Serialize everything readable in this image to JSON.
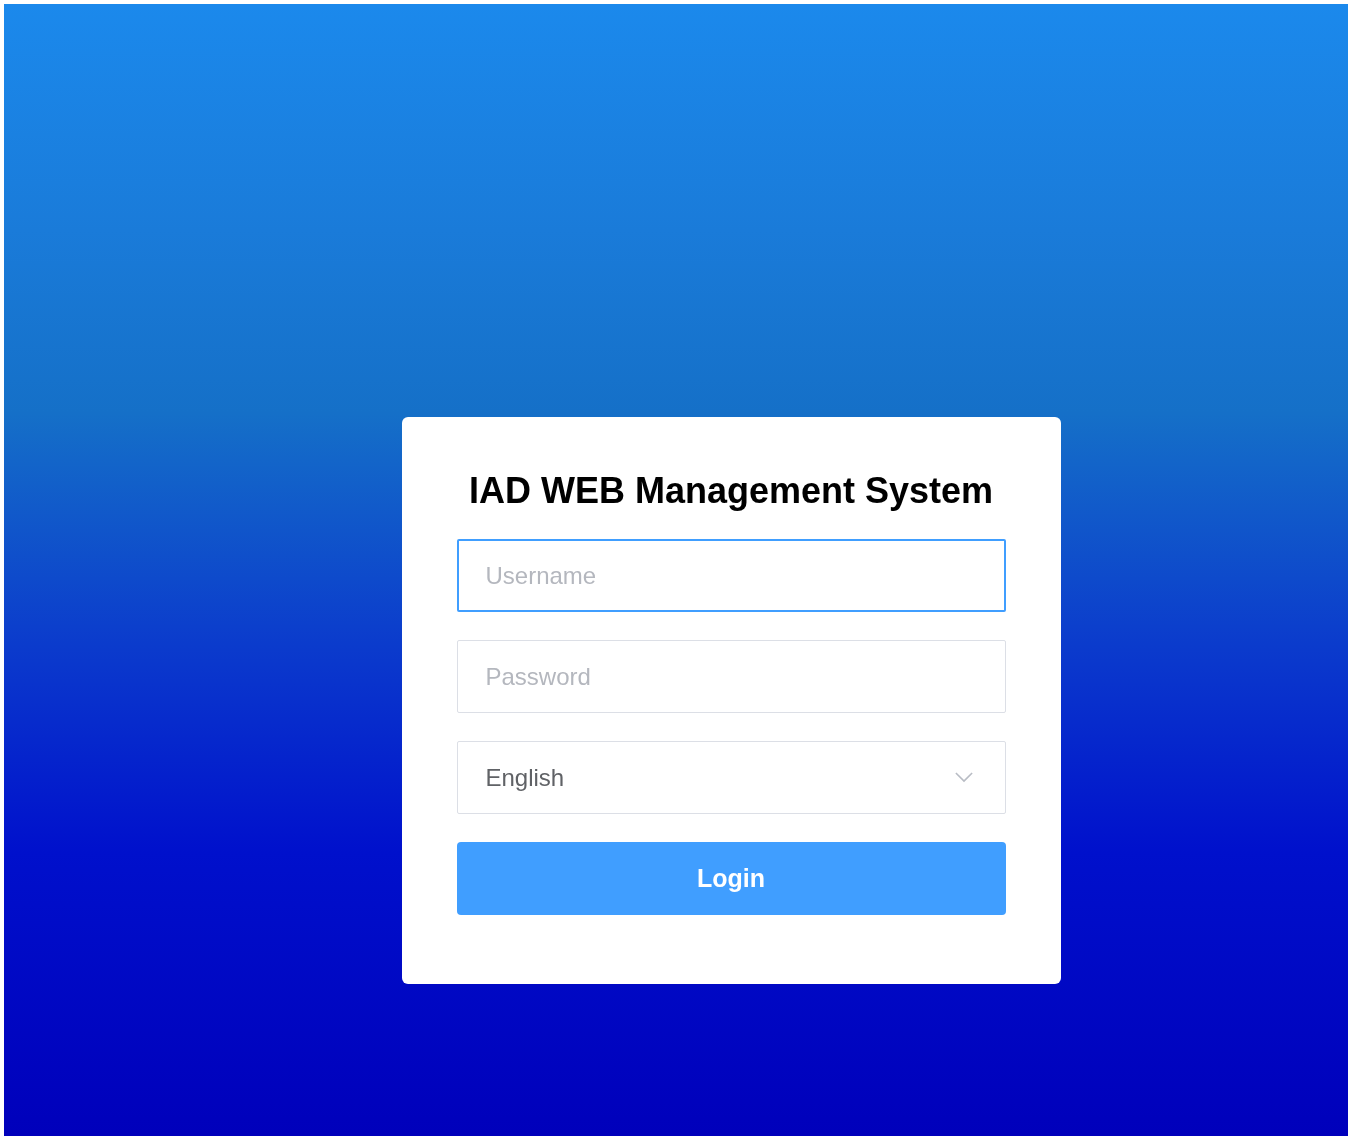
{
  "title": "IAD WEB Management System",
  "fields": [
    {
      "placeholder": "Username",
      "focused": true
    },
    {
      "placeholder": "Password",
      "focused": false
    }
  ],
  "language_select": {
    "value": "English"
  },
  "login_button": {
    "label": "Login"
  }
}
